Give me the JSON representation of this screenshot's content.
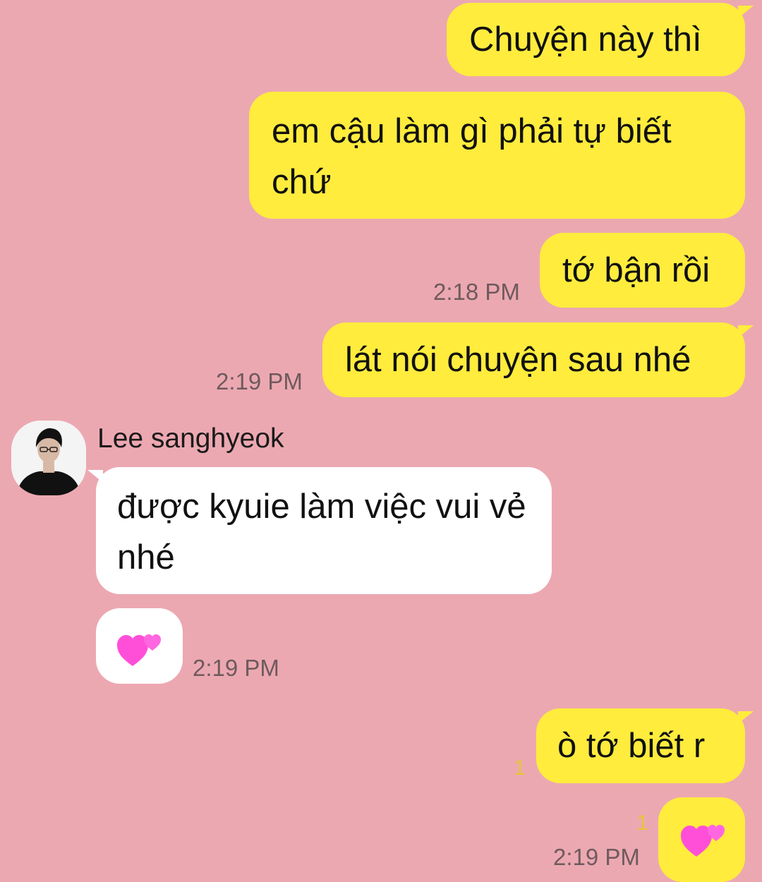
{
  "messages": [
    {
      "text": "Chuyện này thì"
    },
    {
      "text": "em cậu làm gì phải tự biết chứ"
    },
    {
      "text": "tớ bận rồi",
      "time": "2:18 PM"
    },
    {
      "text": "lát nói chuyện sau nhé",
      "time": "2:19 PM"
    },
    {
      "sender": "Lee sanghyeok",
      "text": "được kyuie làm việc vui vẻ nhé"
    },
    {
      "emoji": "two-hearts-icon",
      "time": "2:19 PM"
    },
    {
      "text": "ò tớ biết r",
      "unread": "1"
    },
    {
      "emoji": "two-hearts-icon",
      "unread": "1",
      "time": "2:19 PM"
    }
  ],
  "colors": {
    "background": "#eca8b1",
    "my_bubble": "#ffec3d",
    "their_bubble": "#ffffff",
    "timestamp": "#6e5a5d",
    "unread_badge": "#e8c43a",
    "heart": "#ff4fd8"
  }
}
